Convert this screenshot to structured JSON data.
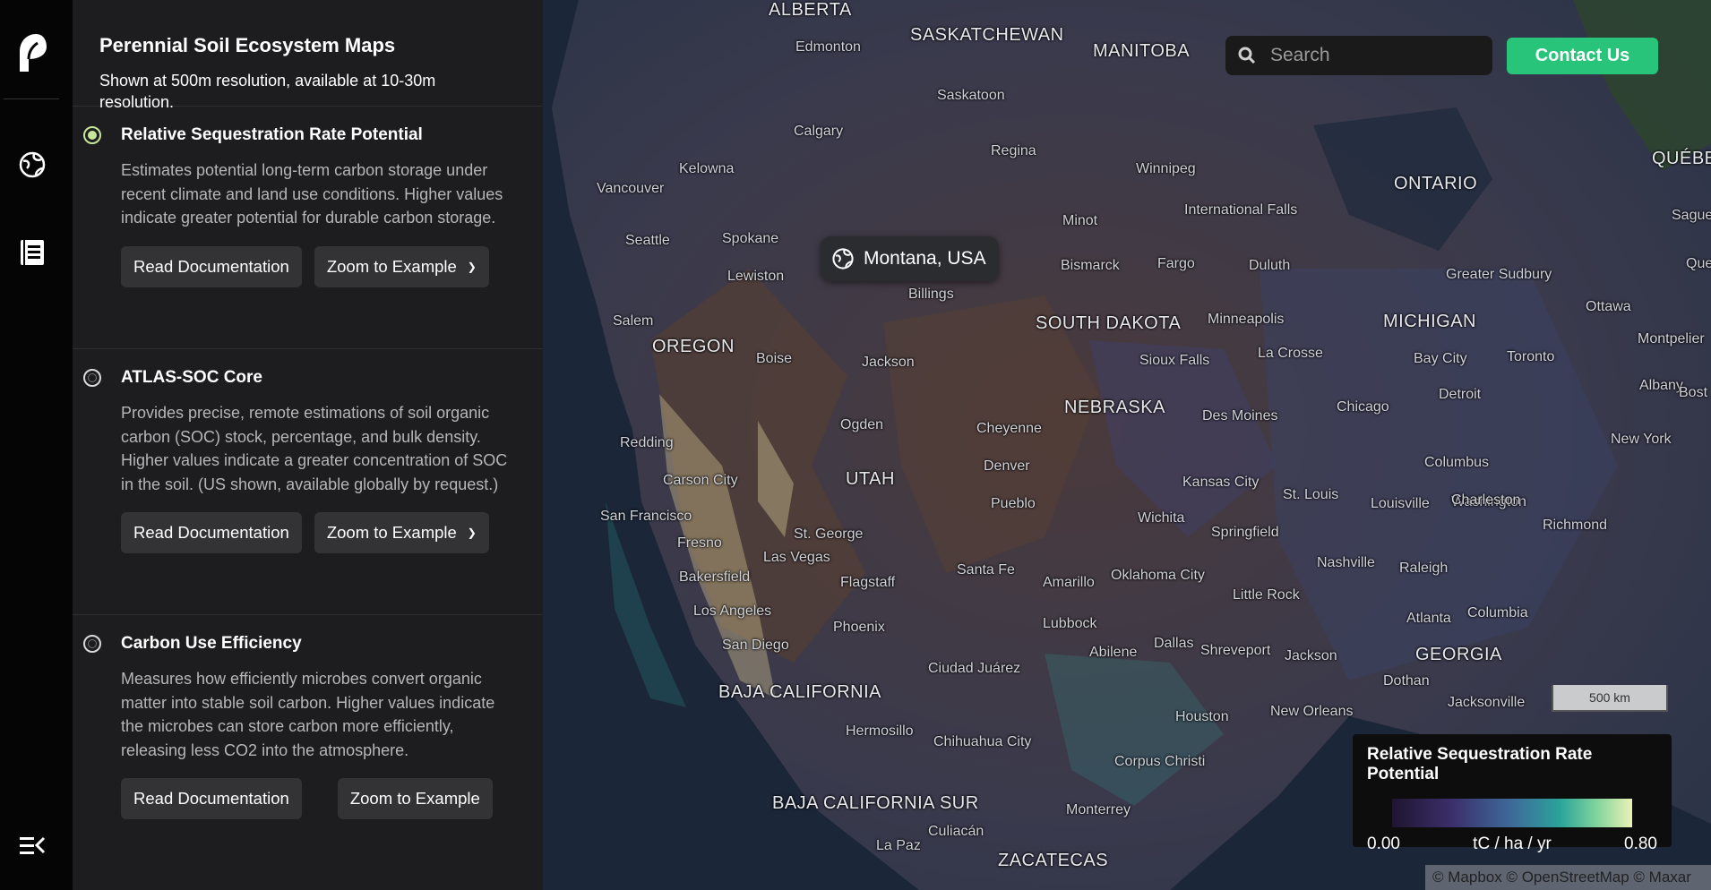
{
  "rail": {
    "logo_icon": "leaf-logo-icon",
    "globe_icon": "globe-icon",
    "docs_icon": "document-icon",
    "menu_icon": "collapse-menu-icon"
  },
  "panel": {
    "title": "Perennial Soil Ecosystem Maps",
    "subtitle": "Shown at 500m resolution, available at 10-30m resolution.",
    "layers": [
      {
        "name": "Relative Sequestration Rate Potential",
        "desc": "Estimates potential long-term carbon storage under recent climate and land use conditions. Higher values indicate greater potential for durable carbon storage.",
        "selected": true,
        "doc_label": "Read Documentation",
        "zoom_label": "Zoom to Example",
        "zoom_dropdown": true
      },
      {
        "name": "ATLAS-SOC Core",
        "desc": "Provides precise, remote estimations of soil organic carbon (SOC) stock, percentage, and bulk density. Higher values indicate a greater concentration of SOC in the soil. (US shown, available globally by request.)",
        "selected": false,
        "doc_label": "Read Documentation",
        "zoom_label": "Zoom to Example",
        "zoom_dropdown": true
      },
      {
        "name": "Carbon Use Efficiency",
        "desc": "Measures how efficiently microbes convert organic matter into stable soil carbon. Higher values indicate the microbes can store carbon more efficiently, releasing less CO2 into the atmosphere.",
        "selected": false,
        "doc_label": "Read Documentation",
        "zoom_label": "Zoom to Example",
        "zoom_dropdown": false
      }
    ]
  },
  "map": {
    "pin_label": "Montana, USA",
    "search_placeholder": "Search",
    "contact_label": "Contact Us",
    "scale_label": "500 km",
    "attribution": "© Mapbox © OpenStreetMap © Maxar",
    "legend": {
      "title": "Relative Sequestration Rate Potential",
      "min": "0.00",
      "unit": "tC / ha / yr",
      "max": "0.80"
    },
    "accent_color": "#27c47a",
    "regions": [
      "ALBERTA",
      "SASKATCHEWAN",
      "MANITOBA",
      "ONTARIO",
      "QUÉBE",
      "MICHIGAN",
      "SOUTH DAKOTA",
      "NEBRASKA",
      "OREGON",
      "UTAH",
      "GEORGIA",
      "BAJA CALIFORNIA",
      "BAJA CALIFORNIA SUR",
      "ZACATECAS"
    ],
    "cities": [
      "Edmonton",
      "Saskatoon",
      "Calgary",
      "Regina",
      "Winnipeg",
      "Kelowna",
      "Vancouver",
      "Seattle",
      "Spokane",
      "Lewiston",
      "Billings",
      "Minot",
      "Bismarck",
      "Fargo",
      "Duluth",
      "International Falls",
      "Salem",
      "Boise",
      "Jackson",
      "Minneapolis",
      "Sioux Falls",
      "La Crosse",
      "Ogden",
      "Cheyenne",
      "Des Moines",
      "Chicago",
      "Detroit",
      "Toronto",
      "Bay City",
      "Ottawa",
      "Albany",
      "New York",
      "Redding",
      "Carson City",
      "Denver",
      "Kansas City",
      "Springfield",
      "Columbus",
      "Washington",
      "San Francisco",
      "Fresno",
      "St. George",
      "Pueblo",
      "Wichita",
      "St. Louis",
      "Louisville",
      "Charleston",
      "Richmond",
      "Bakersfield",
      "Las Vegas",
      "Flagstaff",
      "Santa Fe",
      "Amarillo",
      "Oklahoma City",
      "Nashville",
      "Raleigh",
      "Los Angeles",
      "Phoenix",
      "Lubbock",
      "Little Rock",
      "Atlanta",
      "Columbia",
      "San Diego",
      "Ciudad Juárez",
      "Abilene",
      "Dallas",
      "Shreveport",
      "Jackson",
      "Dothan",
      "Jacksonville",
      "Hermosillo",
      "Chihuahua City",
      "Houston",
      "New Orleans",
      "Corpus Christi",
      "Monterrey",
      "Culiacán",
      "La Paz",
      "Greater Sudbury",
      "Sague",
      "Queb",
      "Montpelier",
      "Bost"
    ]
  }
}
